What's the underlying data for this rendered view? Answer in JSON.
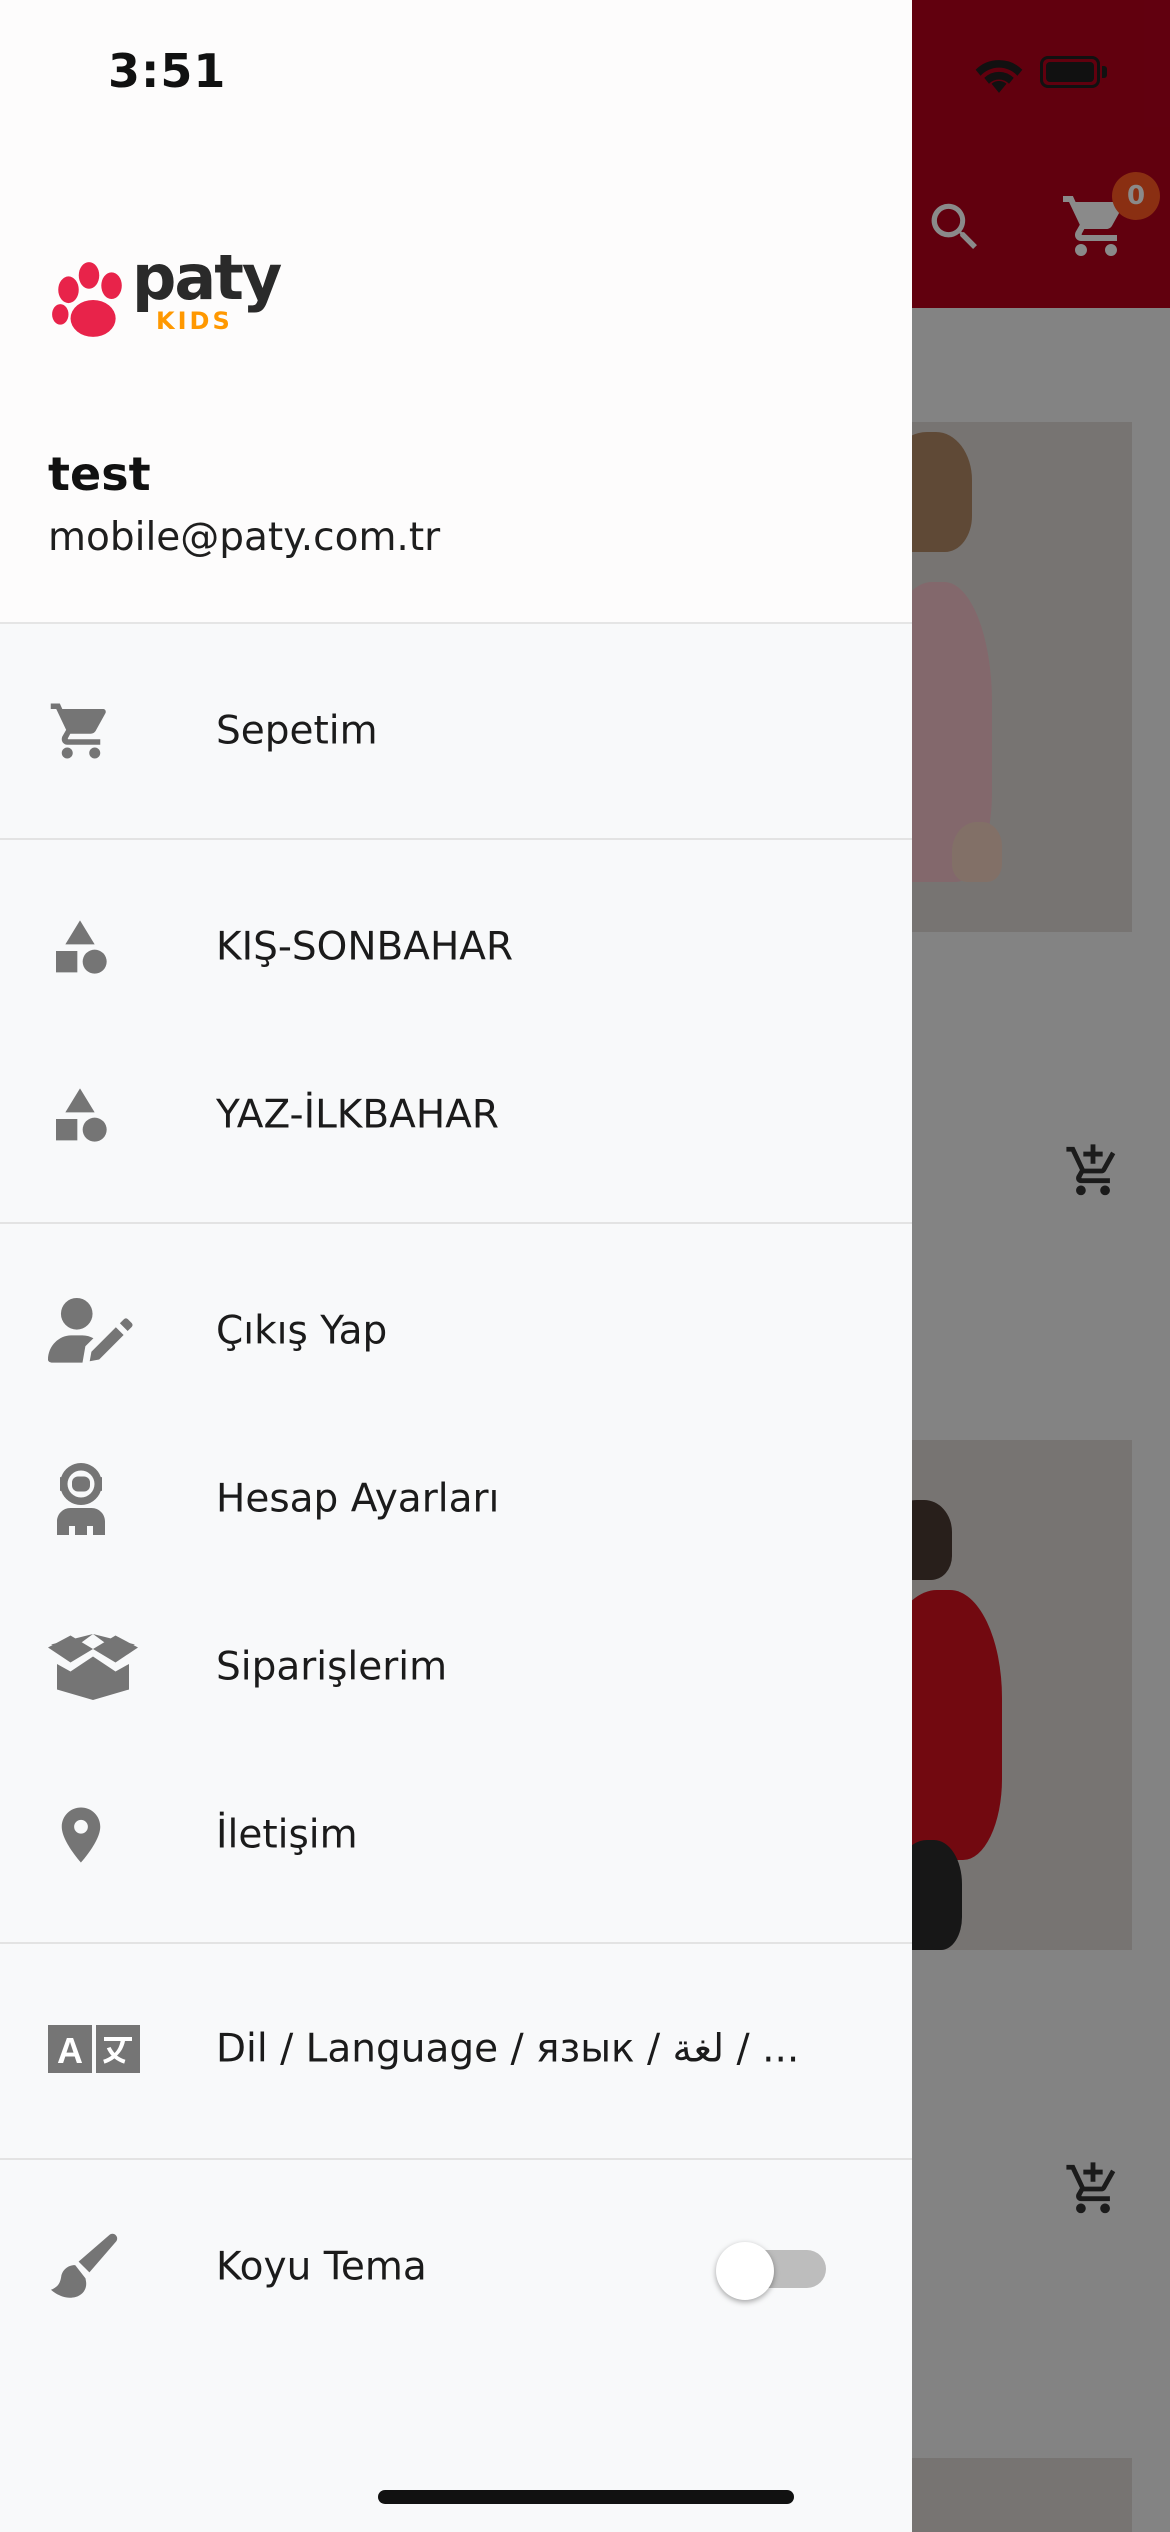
{
  "status_bar": {
    "time": "3:51"
  },
  "app": {
    "cart_badge": "0",
    "colors": {
      "brand_red": "#b3001b",
      "badge": "#ff5722"
    }
  },
  "drawer": {
    "logo": {
      "text": "paty",
      "subtext": "KIDS"
    },
    "user": {
      "name": "test",
      "email": "mobile@paty.com.tr"
    },
    "items": [
      {
        "label": "Sepetim",
        "icon": "cart-icon"
      },
      {
        "label": "KIŞ-SONBAHAR",
        "icon": "shapes-icon"
      },
      {
        "label": "YAZ-İLKBAHAR",
        "icon": "shapes-icon"
      },
      {
        "label": "Çıkış Yap",
        "icon": "user-edit-icon"
      },
      {
        "label": "Hesap Ayarları",
        "icon": "user-astronaut-icon"
      },
      {
        "label": "Siparişlerim",
        "icon": "box-open-icon"
      },
      {
        "label": "İletişim",
        "icon": "map-marker-icon"
      },
      {
        "label": "Dil / Language / язык / لغة / ...",
        "icon": "translate-icon"
      },
      {
        "label": "Koyu Tema",
        "icon": "paint-brush-icon"
      }
    ],
    "dark_theme_enabled": false
  }
}
